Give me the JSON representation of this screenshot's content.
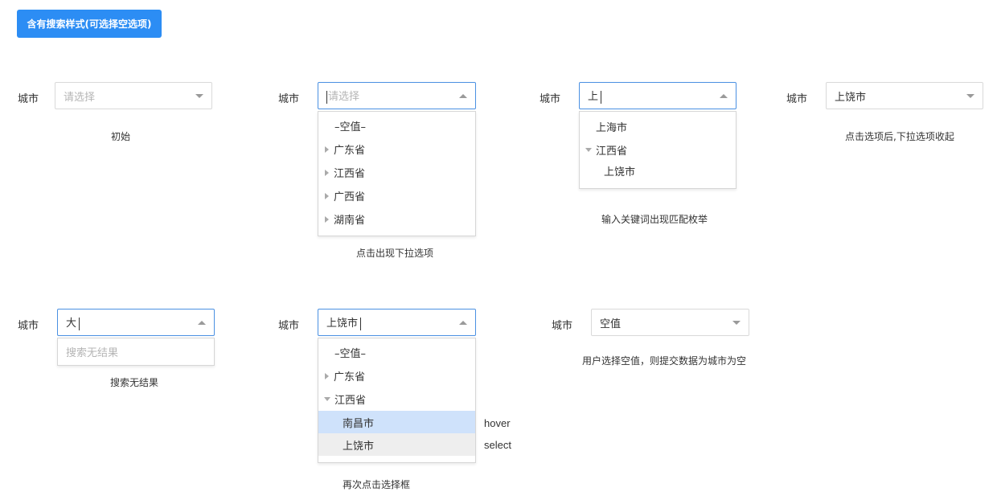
{
  "header": {
    "title": "含有搜索样式(可选择空选项)"
  },
  "label_city": "城市",
  "demo1": {
    "placeholder": "请选择",
    "caption": "初始"
  },
  "demo2": {
    "placeholder": "请选择",
    "options": [
      "–空值–",
      "广东省",
      "江西省",
      "广西省",
      "湖南省"
    ],
    "caption": "点击出现下拉选项"
  },
  "demo3": {
    "input": "上",
    "options": [
      "上海市",
      "江西省",
      "上饶市"
    ],
    "caption": "输入关键词出现匹配枚举"
  },
  "demo4": {
    "value": "上饶市",
    "caption": "点击选项后,下拉选项收起"
  },
  "demo5": {
    "input": "大",
    "empty_text": "搜索无结果",
    "caption": "搜索无结果"
  },
  "demo6": {
    "input": "上饶市",
    "options": [
      "–空值–",
      "广东省",
      "江西省",
      "南昌市",
      "上饶市"
    ],
    "hover_label": "hover",
    "select_label": "select",
    "caption": "再次点击选择框"
  },
  "demo7": {
    "value": "空值",
    "caption": "用户选择空值，则提交数据为城市为空"
  },
  "colors": {
    "primary": "#2c8df4",
    "hover_bg": "#cfe2fb",
    "selected_bg": "#eeeeee",
    "focus_border": "#4a90e2"
  }
}
